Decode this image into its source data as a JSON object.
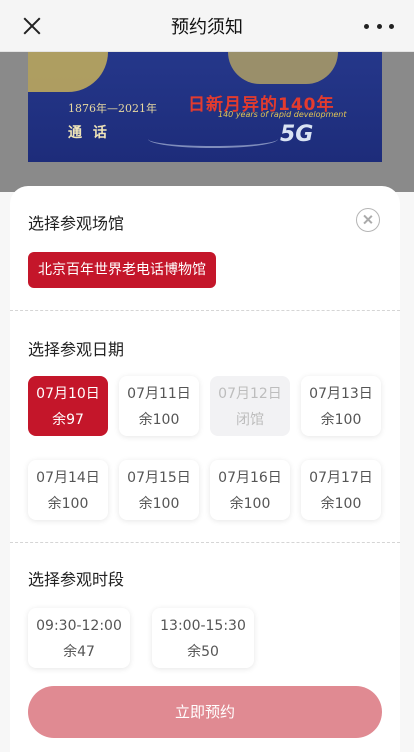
{
  "header": {
    "title": "预约须知"
  },
  "banner": {
    "years": "1876年—2021年",
    "title": "日新月异的140年",
    "subtitle_en": "140 years of rapid development",
    "left_text": "通 话",
    "right_text": "5G"
  },
  "venue_section": {
    "title": "选择参观场馆",
    "selected_venue": "北京百年世界老电话博物馆"
  },
  "date_section": {
    "title": "选择参观日期",
    "dates": [
      {
        "date": "07月10日",
        "remaining": "余97",
        "state": "selected"
      },
      {
        "date": "07月11日",
        "remaining": "余100",
        "state": "available"
      },
      {
        "date": "07月12日",
        "remaining": "闭馆",
        "state": "closed"
      },
      {
        "date": "07月13日",
        "remaining": "余100",
        "state": "available"
      },
      {
        "date": "07月14日",
        "remaining": "余100",
        "state": "available"
      },
      {
        "date": "07月15日",
        "remaining": "余100",
        "state": "available"
      },
      {
        "date": "07月16日",
        "remaining": "余100",
        "state": "available"
      },
      {
        "date": "07月17日",
        "remaining": "余100",
        "state": "available"
      }
    ]
  },
  "time_section": {
    "title": "选择参观时段",
    "slots": [
      {
        "time": "09:30-12:00",
        "remaining": "余47"
      },
      {
        "time": "13:00-15:30",
        "remaining": "余50"
      }
    ]
  },
  "actions": {
    "book_label": "立即预约"
  },
  "colors": {
    "accent": "#c4162a",
    "button_disabled": "#e08a92"
  }
}
